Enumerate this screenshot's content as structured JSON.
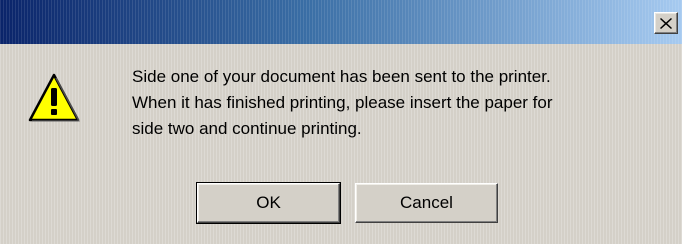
{
  "dialog": {
    "close_glyph": "X",
    "icon": "warning-icon",
    "message_lines": [
      "Side one of your document has been sent to the printer.",
      "When it has finished printing, please insert the paper for",
      "side two and continue printing."
    ],
    "buttons": {
      "ok_label": "OK",
      "cancel_label": "Cancel"
    }
  },
  "colors": {
    "face": "#d4d0c8",
    "title_start": "#0a246a",
    "title_end": "#a6caf0",
    "warning_fill": "#ffff00"
  }
}
